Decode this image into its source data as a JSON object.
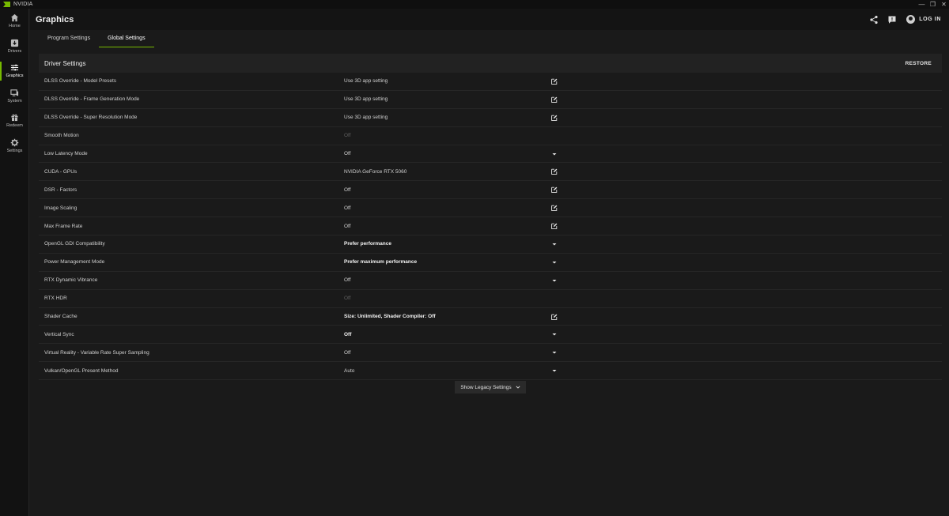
{
  "window": {
    "app_name": "NVIDIA",
    "controls": [
      "—",
      "❐",
      "✕"
    ]
  },
  "sidebar": {
    "items": [
      {
        "label": "Home",
        "icon": "home-icon",
        "active": false
      },
      {
        "label": "Drivers",
        "icon": "drivers-icon",
        "active": false
      },
      {
        "label": "Graphics",
        "icon": "sliders-icon",
        "active": true
      },
      {
        "label": "System",
        "icon": "monitor-icon",
        "active": false
      },
      {
        "label": "Redeem",
        "icon": "gift-icon",
        "active": false
      },
      {
        "label": "Settings",
        "icon": "gear-icon",
        "active": false
      }
    ]
  },
  "header": {
    "title": "Graphics",
    "login_label": "LOG IN"
  },
  "tabs": [
    {
      "label": "Program Settings",
      "active": false
    },
    {
      "label": "Global Settings",
      "active": true
    }
  ],
  "panel": {
    "title": "Driver Settings",
    "restore_label": "RESTORE"
  },
  "settings": [
    {
      "name": "DLSS Override - Model Presets",
      "value": "Use 3D app setting",
      "style": "normal",
      "control": "edit"
    },
    {
      "name": "DLSS Override - Frame Generation Mode",
      "value": "Use 3D app setting",
      "style": "normal",
      "control": "edit"
    },
    {
      "name": "DLSS Override - Super Resolution Mode",
      "value": "Use 3D app setting",
      "style": "normal",
      "control": "edit"
    },
    {
      "name": "Smooth Motion",
      "value": "Off",
      "style": "dim",
      "control": "none"
    },
    {
      "name": "Low Latency Mode",
      "value": "Off",
      "style": "normal",
      "control": "dropdown"
    },
    {
      "name": "CUDA - GPUs",
      "value": "NVIDIA GeForce RTX 5060",
      "style": "normal",
      "control": "edit"
    },
    {
      "name": "DSR - Factors",
      "value": "Off",
      "style": "normal",
      "control": "edit"
    },
    {
      "name": "Image Scaling",
      "value": "Off",
      "style": "normal",
      "control": "edit"
    },
    {
      "name": "Max Frame Rate",
      "value": "Off",
      "style": "normal",
      "control": "edit"
    },
    {
      "name": "OpenGL GDI Compatibility",
      "value": "Prefer performance",
      "style": "bold",
      "control": "dropdown"
    },
    {
      "name": "Power Management Mode",
      "value": "Prefer maximum performance",
      "style": "bold",
      "control": "dropdown"
    },
    {
      "name": "RTX Dynamic Vibrance",
      "value": "Off",
      "style": "normal",
      "control": "dropdown"
    },
    {
      "name": "RTX HDR",
      "value": "Off",
      "style": "dim",
      "control": "none"
    },
    {
      "name": "Shader Cache",
      "value": "Size: Unlimited, Shader Compiler: Off",
      "style": "bold",
      "control": "edit"
    },
    {
      "name": "Vertical Sync",
      "value": "Off",
      "style": "bold",
      "control": "dropdown"
    },
    {
      "name": "Virtual Reality - Variable Rate Super Sampling",
      "value": "Off",
      "style": "normal",
      "control": "dropdown"
    },
    {
      "name": "Vulkan/OpenGL Present Method",
      "value": "Auto",
      "style": "normal",
      "control": "dropdown"
    }
  ],
  "legacy_button_label": "Show Legacy Settings",
  "colors": {
    "accent": "#76b900",
    "background": "#1a1a1a",
    "panel_header": "#222222"
  }
}
